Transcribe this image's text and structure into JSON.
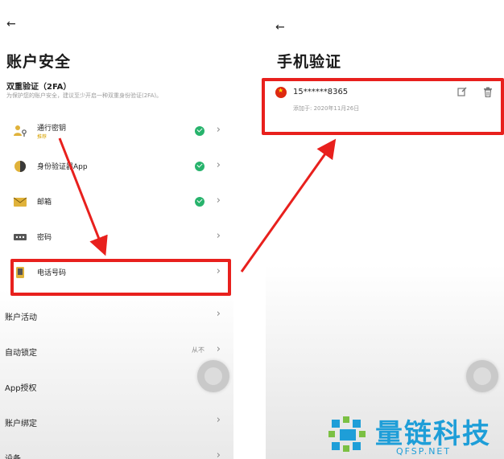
{
  "left": {
    "back": "←",
    "title": "账户安全",
    "twofa": {
      "title": "双重验证（2FA）",
      "desc": "为保护您的账户安全，建议至少开启一种双重身份验证(2FA)。"
    },
    "items": [
      {
        "label": "通行密钥",
        "sub": "推荐",
        "icon": "passkey-icon",
        "verified": true
      },
      {
        "label": "身份验证器App",
        "icon": "authenticator-icon",
        "verified": true
      },
      {
        "label": "邮箱",
        "icon": "email-icon",
        "verified": true
      },
      {
        "label": "密码",
        "icon": "password-icon",
        "verified": false
      },
      {
        "label": "电话号码",
        "icon": "phone-icon",
        "verified": false
      }
    ],
    "settings": [
      {
        "label": "账户活动",
        "value": ""
      },
      {
        "label": "自动锁定",
        "value": "从不"
      },
      {
        "label": "App授权",
        "value": ""
      },
      {
        "label": "账户绑定",
        "value": ""
      },
      {
        "label": "设备",
        "value": ""
      }
    ],
    "chevron": "›"
  },
  "right": {
    "back": "←",
    "title": "手机验证",
    "phone": {
      "number": "15******8365",
      "added": "添加于: 2020年11月26日",
      "flag_icon": "china-flag-icon"
    }
  },
  "watermark": {
    "brand": "量链科技",
    "site": "QFSP.NET"
  },
  "colors": {
    "highlight": "#e8201d",
    "check": "#27b36c",
    "brand": "#1e9ed8"
  }
}
